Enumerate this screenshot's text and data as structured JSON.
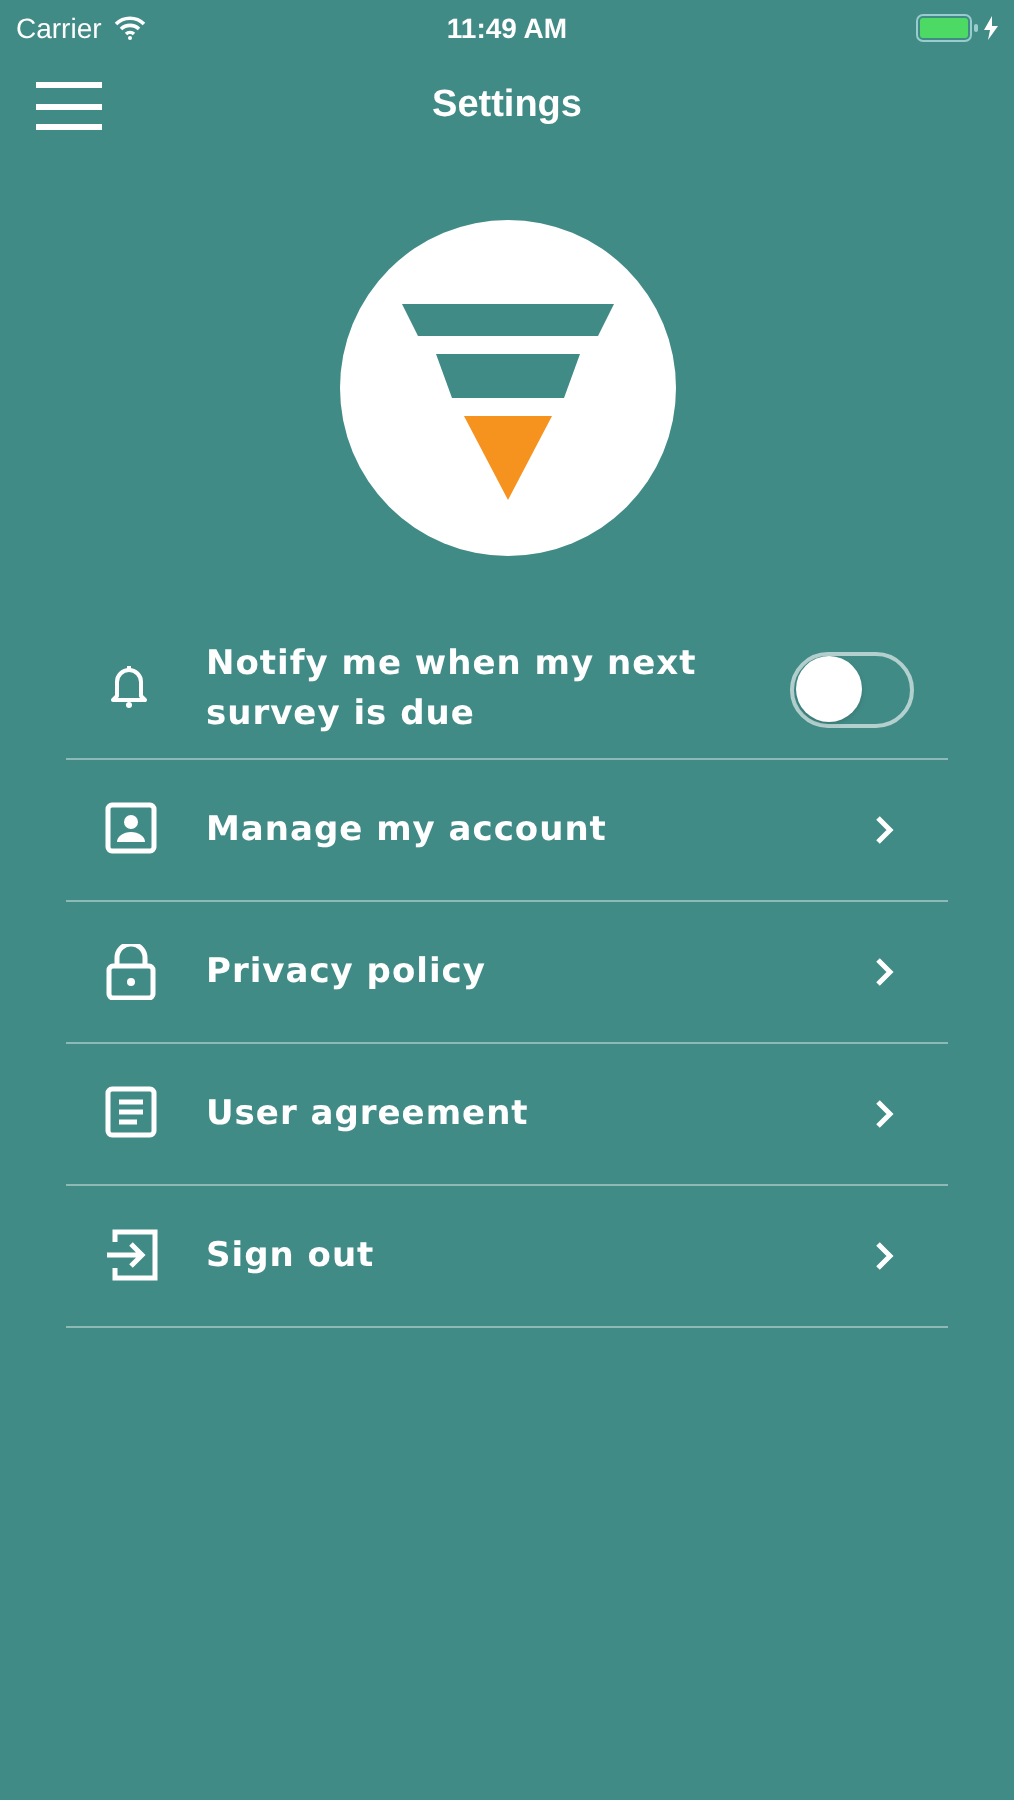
{
  "status_bar": {
    "carrier": "Carrier",
    "time": "11:49 AM"
  },
  "nav_bar": {
    "title": "Settings"
  },
  "settings": [
    {
      "kind": "toggle",
      "label": "Notify me when my next survey is due",
      "on": false
    },
    {
      "kind": "link",
      "label": "Manage my account"
    },
    {
      "kind": "link",
      "label": "Privacy policy"
    },
    {
      "kind": "link",
      "label": "User agreement"
    },
    {
      "kind": "link",
      "label": "Sign out"
    }
  ]
}
